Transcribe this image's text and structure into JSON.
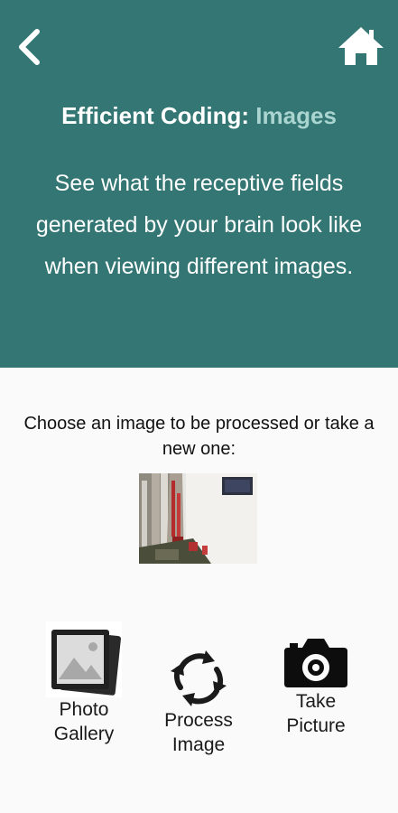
{
  "header": {
    "title_prefix": "Efficient Coding:",
    "title_accent": "Images",
    "description": "See what the receptive fields generated by your brain look like when viewing different images."
  },
  "main": {
    "prompt": "Choose an image to be processed or take a new one:"
  },
  "actions": [
    {
      "line1": "Photo",
      "line2": "Gallery",
      "icon": "photo-gallery-icon"
    },
    {
      "line1": "Process",
      "line2": "Image",
      "icon": "refresh-cycle-icon"
    },
    {
      "line1": "Take",
      "line2": "Picture",
      "icon": "camera-icon"
    }
  ],
  "colors": {
    "header_bg": "#337673",
    "title_accent": "#a9d4cf",
    "page_bg": "#fafafa"
  }
}
